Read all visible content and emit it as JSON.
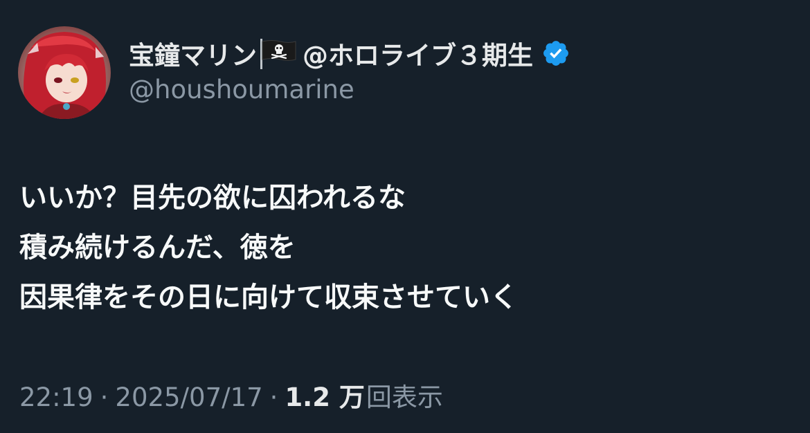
{
  "author": {
    "display_name": "宝鐘マリン",
    "affiliation": "@ホロライブ３期生",
    "handle": "@houshoumarine",
    "flag_icon": "pirate-flag-icon",
    "verified_icon": "verified-badge-icon",
    "verified_color": "#1d9bf0"
  },
  "body": {
    "lines": [
      "いいか？目先の欲に囚われるな",
      "積み続けるんだ、徳を",
      "因果律をその日に向けて収束させていく"
    ]
  },
  "meta": {
    "time": "22:19",
    "separator": "·",
    "date": "2025/07/17",
    "views_count": "1.2 万",
    "views_label": "回表示"
  },
  "colors": {
    "background": "#16202a",
    "primary_text": "#e7e9ea",
    "secondary_text": "#8b98a5"
  }
}
